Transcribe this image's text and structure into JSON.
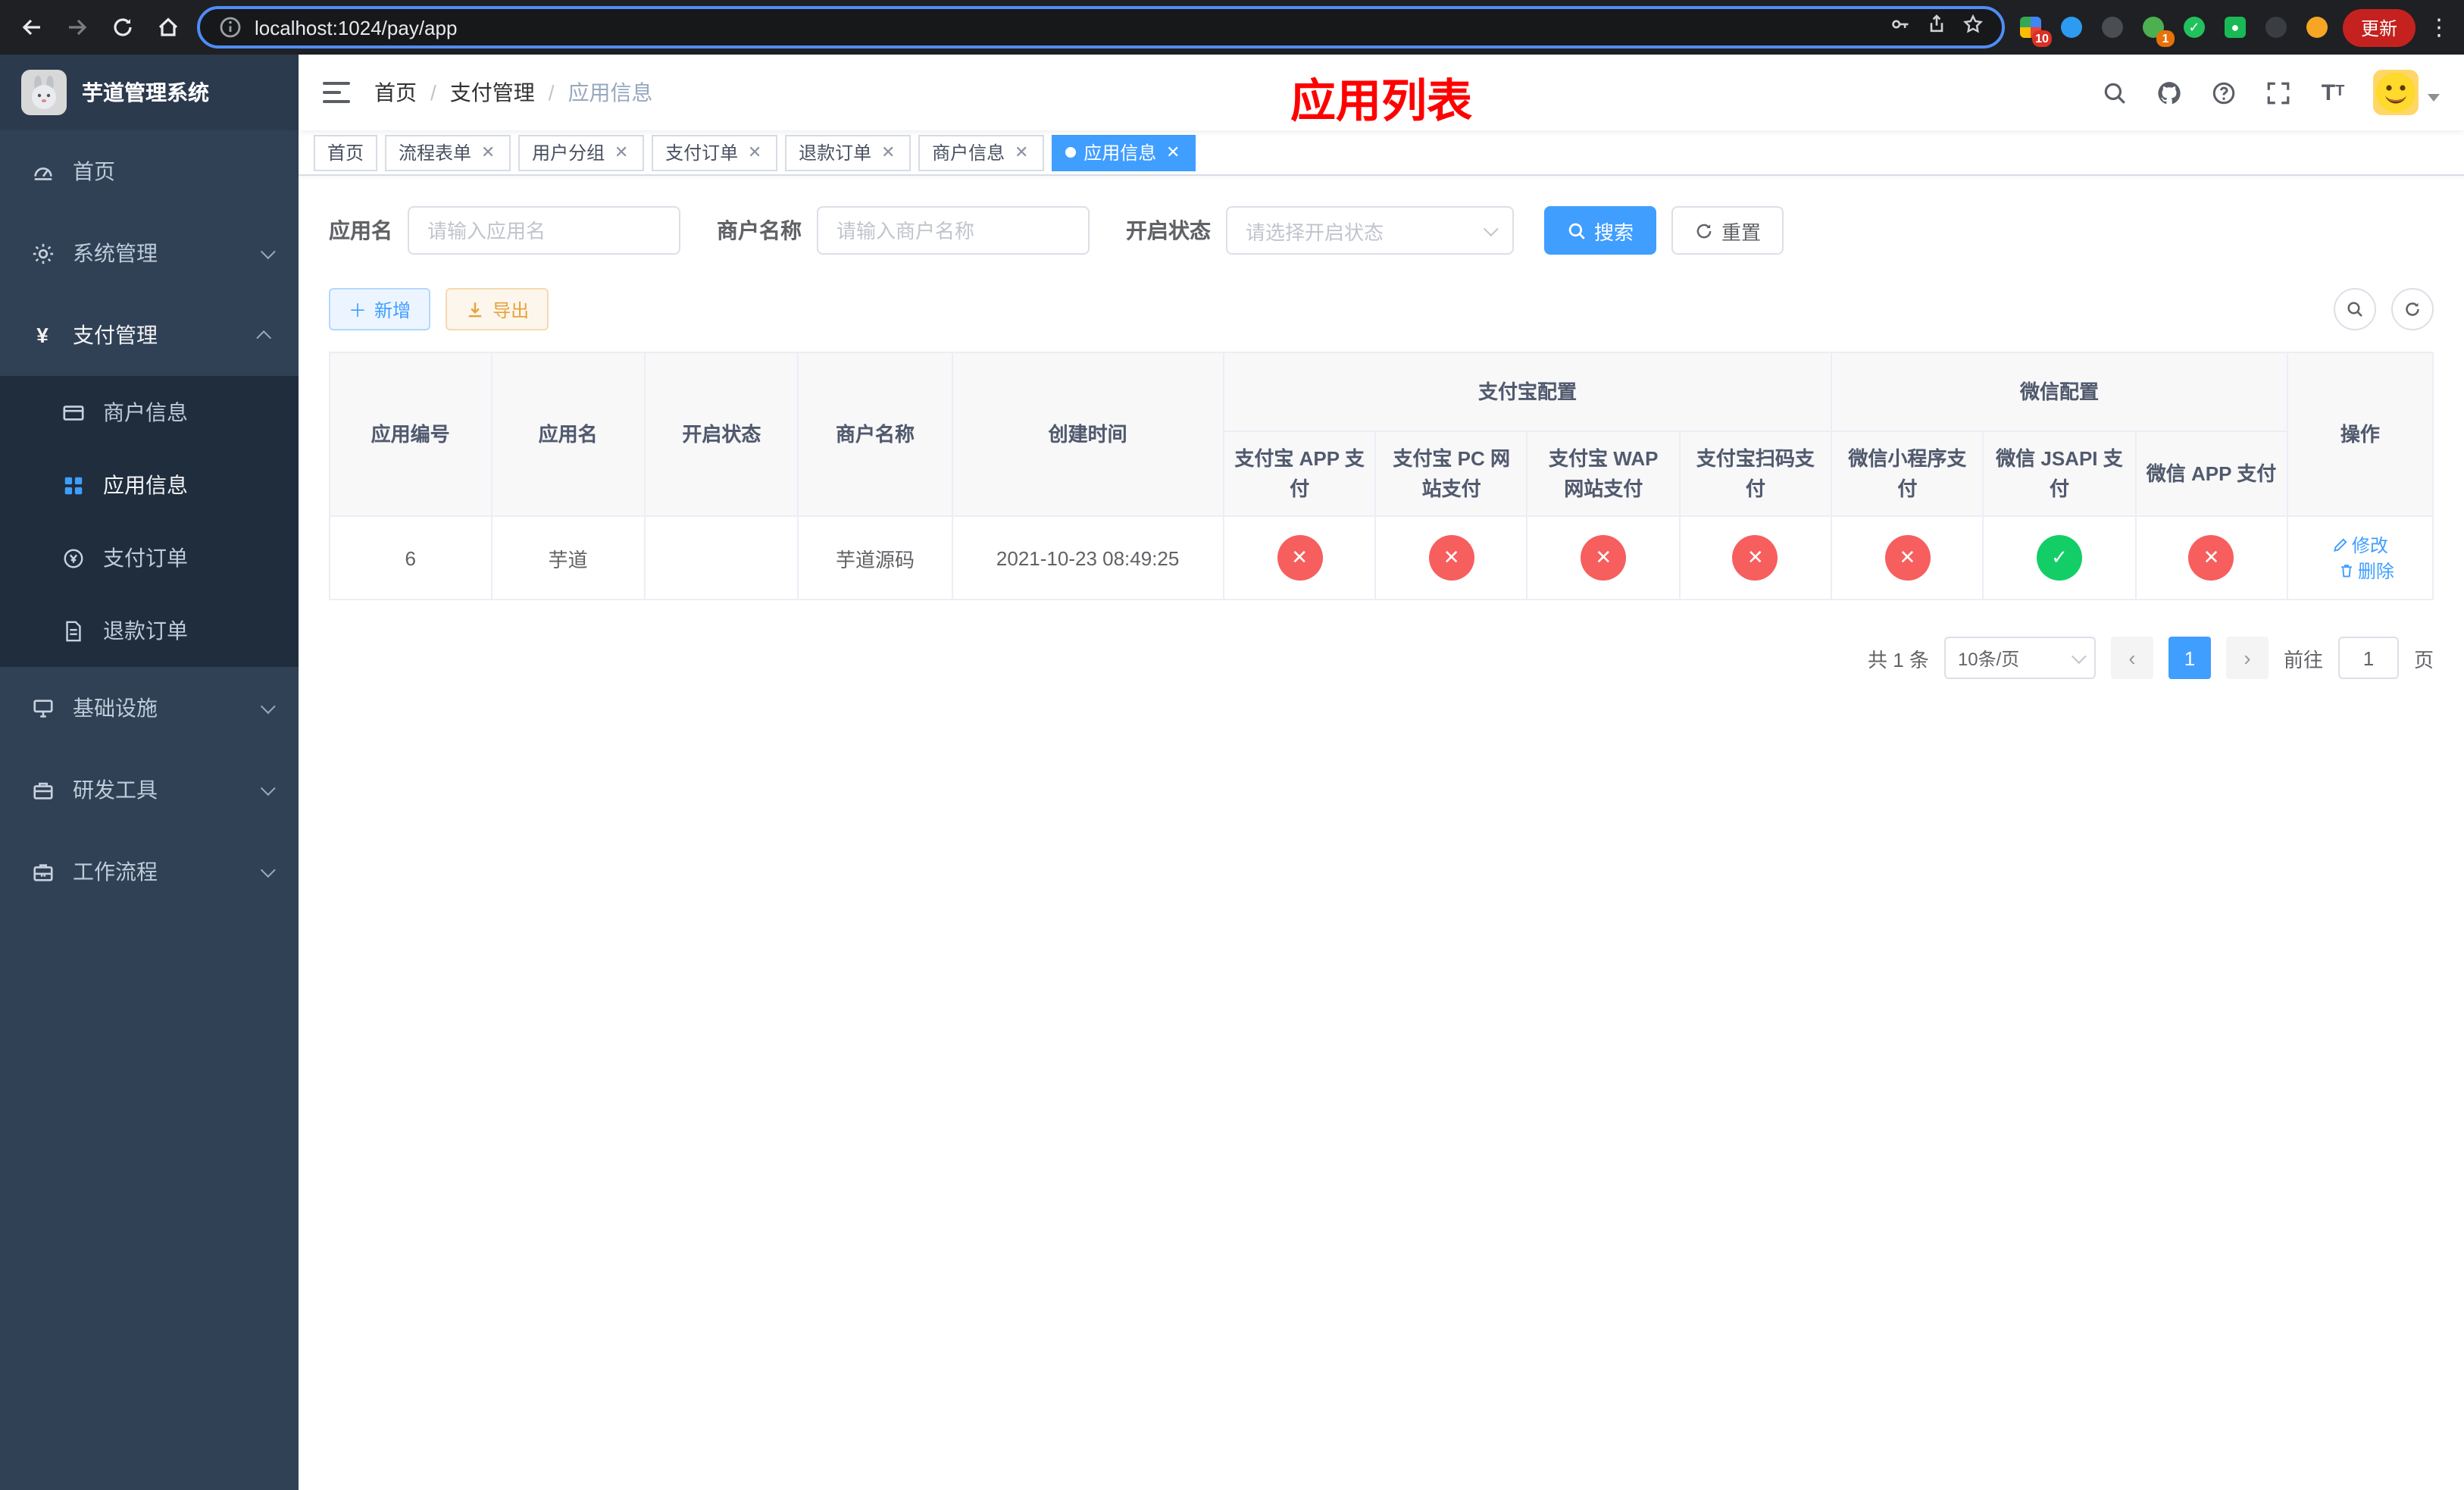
{
  "browser": {
    "url": "localhost:1024/pay/app",
    "update_label": "更新",
    "ext_badge_grid": "10",
    "ext_badge_avatar": "1"
  },
  "sidebar": {
    "title": "芋道管理系统",
    "items": {
      "home": "首页",
      "system": "系统管理",
      "pay": "支付管理",
      "infra": "基础设施",
      "dev": "研发工具",
      "flow": "工作流程"
    },
    "pay_children": {
      "merchant": "商户信息",
      "app": "应用信息",
      "order": "支付订单",
      "refund": "退款订单"
    }
  },
  "header": {
    "breadcrumb": [
      "首页",
      "支付管理",
      "应用信息"
    ],
    "banner": "应用列表"
  },
  "tabs": [
    {
      "label": "首页"
    },
    {
      "label": "流程表单"
    },
    {
      "label": "用户分组"
    },
    {
      "label": "支付订单"
    },
    {
      "label": "退款订单"
    },
    {
      "label": "商户信息"
    },
    {
      "label": "应用信息"
    }
  ],
  "filters": {
    "app_name_label": "应用名",
    "app_name_placeholder": "请输入应用名",
    "merchant_name_label": "商户名称",
    "merchant_name_placeholder": "请输入商户名称",
    "status_label": "开启状态",
    "status_placeholder": "请选择开启状态",
    "search_label": "搜索",
    "reset_label": "重置"
  },
  "toolbar": {
    "add_label": "新增",
    "export_label": "导出"
  },
  "table": {
    "headers": {
      "app_id": "应用编号",
      "app_name": "应用名",
      "status": "开启状态",
      "merchant": "商户名称",
      "created": "创建时间",
      "alipay_group": "支付宝配置",
      "wechat_group": "微信配置",
      "ops": "操作",
      "sub": [
        "支付宝 APP 支付",
        "支付宝 PC 网站支付",
        "支付宝 WAP 网站支付",
        "支付宝扫码支付",
        "微信小程序支付",
        "微信 JSAPI 支付",
        "微信 APP 支付"
      ]
    },
    "rows": [
      {
        "app_id": "6",
        "app_name": "芋道",
        "status_on": "on",
        "merchant": "芋道源码",
        "created": "2021-10-23 08:49:25",
        "configs": [
          "no",
          "no",
          "no",
          "no",
          "no",
          "yes",
          "no"
        ],
        "edit_label": "修改",
        "delete_label": "删除"
      }
    ]
  },
  "pagination": {
    "total": "共 1 条",
    "page_size": "10条/页",
    "page": "1",
    "goto_label": "前往",
    "goto_value": "1",
    "page_unit": "页"
  }
}
